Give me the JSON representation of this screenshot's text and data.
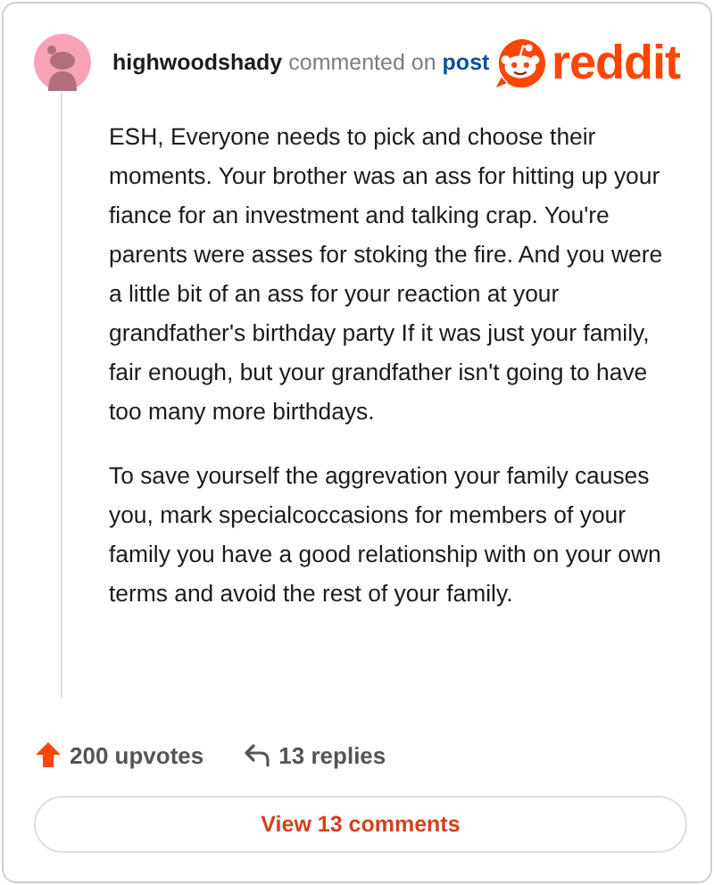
{
  "header": {
    "username": "highwoodshady",
    "action": "commented on",
    "link": "post",
    "logo_text": "reddit"
  },
  "comment": {
    "paragraphs": [
      "ESH, Everyone needs to pick and choose their moments. Your brother was an ass for hitting up your fiance for an investment and talking crap. You're parents were asses for stoking the fire. And you were a little bit of an ass for your reaction at your grandfather's birthday party If it was just your family, fair enough, but your grandfather isn't going to have too many more birthdays.",
      "To save yourself the aggrevation your family causes you, mark specialcoccasions for members of your family you have a good relationship with on your own terms and avoid the rest of your family."
    ]
  },
  "footer": {
    "upvotes": "200 upvotes",
    "replies": "13 replies",
    "button": "View 13 comments"
  }
}
